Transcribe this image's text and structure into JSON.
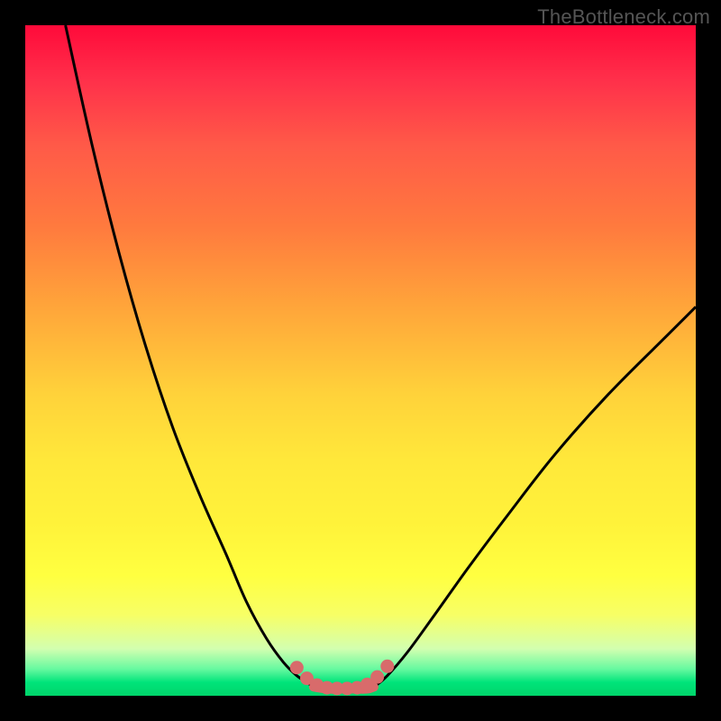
{
  "watermark": {
    "text": "TheBottleneck.com"
  },
  "chart_data": {
    "type": "line",
    "title": "",
    "xlabel": "",
    "ylabel": "",
    "xlim": [
      0,
      100
    ],
    "ylim": [
      0,
      100
    ],
    "grid": false,
    "legend": false,
    "series": [
      {
        "name": "left-curve",
        "x": [
          6,
          10,
          14,
          18,
          22,
          26,
          30,
          33,
          36,
          38.5,
          40.5,
          42,
          43
        ],
        "y": [
          100,
          82,
          66,
          52,
          40,
          30,
          21,
          14,
          8.5,
          5,
          3,
          2,
          1.3
        ]
      },
      {
        "name": "right-curve",
        "x": [
          52,
          54,
          57,
          61,
          66,
          72,
          79,
          87,
          96,
          100
        ],
        "y": [
          1.3,
          3,
          6.5,
          12,
          19,
          27,
          36,
          45,
          54,
          58
        ]
      },
      {
        "name": "plateau",
        "x": [
          43,
          45,
          47,
          49,
          51,
          52
        ],
        "y": [
          1.3,
          1.0,
          1.0,
          1.0,
          1.0,
          1.3
        ]
      }
    ],
    "markers": {
      "name": "plateau-dots",
      "color": "#d86b6b",
      "x": [
        40.5,
        42,
        43.5,
        45,
        46.5,
        48,
        49.5,
        51,
        52.5,
        54
      ],
      "y": [
        4.2,
        2.6,
        1.6,
        1.2,
        1.1,
        1.1,
        1.2,
        1.7,
        2.8,
        4.4
      ]
    },
    "gradient_stops": [
      {
        "offset": 0,
        "color": "#ff0a3a"
      },
      {
        "offset": 18,
        "color": "#ff5a48"
      },
      {
        "offset": 42,
        "color": "#ffa53a"
      },
      {
        "offset": 65,
        "color": "#ffe83a"
      },
      {
        "offset": 82,
        "color": "#ffff40"
      },
      {
        "offset": 96,
        "color": "#67f9a0"
      },
      {
        "offset": 100,
        "color": "#00d46a"
      }
    ]
  }
}
